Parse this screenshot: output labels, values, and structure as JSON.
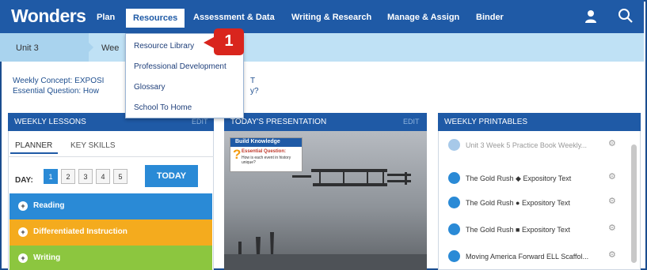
{
  "app": {
    "logo": "Wonders"
  },
  "nav": {
    "items": [
      {
        "label": "Plan"
      },
      {
        "label": "Resources",
        "active": true
      },
      {
        "label": "Assessment & Data"
      },
      {
        "label": "Writing & Research"
      },
      {
        "label": "Manage & Assign"
      },
      {
        "label": "Binder"
      }
    ],
    "icons": [
      "user-icon",
      "search-icon"
    ]
  },
  "breadcrumb": {
    "unit": "Unit 3",
    "week": "Wee"
  },
  "concept": {
    "concept_label": "Weekly Concept: EXPOSI",
    "concept_tail": "T",
    "question_label": "Essential Question: How",
    "question_tail": "y?"
  },
  "resources_menu": {
    "items": [
      "Resource Library",
      "Professional Development",
      "Glossary",
      "School To Home"
    ],
    "callout": "1"
  },
  "weekly_lessons": {
    "title": "WEEKLY LESSONS",
    "edit": "EDIT",
    "tabs": [
      "PLANNER",
      "KEY SKILLS"
    ],
    "day_label": "DAY:",
    "days": [
      "1",
      "2",
      "3",
      "4",
      "5"
    ],
    "today": "TODAY",
    "sections": [
      "Reading",
      "Differentiated Instruction",
      "Writing"
    ]
  },
  "presentation": {
    "title": "TODAY'S PRESENTATION",
    "edit": "EDIT",
    "card_title": "Build Knowledge",
    "card_question": "Essential Question:",
    "card_text": "How is each event in history unique?"
  },
  "printables": {
    "title": "WEEKLY PRINTABLES",
    "items": [
      "Unit 3 Week 5 Practice Book Weekly...",
      "The Gold Rush ◆ Expository Text",
      "The Gold Rush ● Expository Text",
      "The Gold Rush ■ Expository Text",
      "Moving America Forward  ELL Scaffol..."
    ]
  },
  "colors": {
    "nav": "#1f5aa6",
    "breadcrumb": "#bfe1f5",
    "reading": "#2a8ad6",
    "differentiated": "#f4ab1e",
    "writing": "#8cc63f",
    "callout": "#d9251d"
  }
}
